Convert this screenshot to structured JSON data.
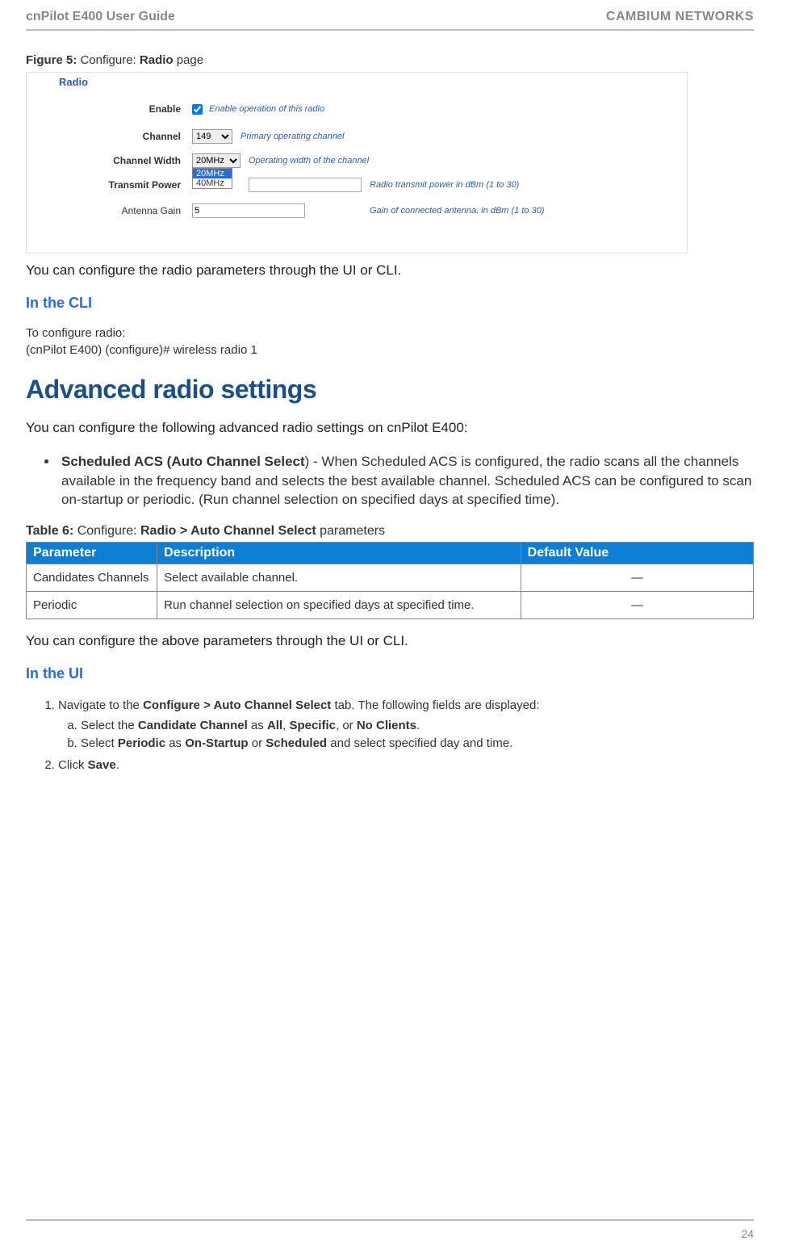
{
  "header": {
    "left": "cnPilot E400 User Guide",
    "right": "CAMBIUM NETWORKS"
  },
  "figure": {
    "label_prefix": "Figure 5:",
    "label_mid": " Configure: ",
    "label_bold": "Radio",
    "label_suffix": " page"
  },
  "radio_panel": {
    "title": "Radio",
    "rows": {
      "enable": {
        "label": "Enable",
        "hint": "Enable operation of this radio",
        "checked": true
      },
      "channel": {
        "label": "Channel",
        "value": "149",
        "hint": "Primary operating channel"
      },
      "channel_width": {
        "label": "Channel Width",
        "value": "20MHz",
        "hint": "Operating width of the channel",
        "options": [
          "20MHz",
          "40MHz"
        ],
        "selected_option": "20MHz"
      },
      "tx_power": {
        "label": "Transmit Power",
        "value": "",
        "hint": "Radio transmit power in dBm (1 to 30)"
      },
      "antenna_gain": {
        "label": "Antenna Gain",
        "value": "5",
        "hint": "Gain of connected antenna, in dBm (1 to 30)"
      }
    }
  },
  "body": {
    "after_figure": "You can configure the radio parameters through the UI or CLI.",
    "cli_heading": "In the CLI",
    "cli_line1": "To configure radio:",
    "cli_line2": "(cnPilot E400) (configure)# wireless radio 1",
    "advanced_heading": "Advanced radio settings",
    "advanced_intro": "You can configure the following advanced radio settings on cnPilot E400:",
    "bullet_bold": "Scheduled ACS (Auto Channel Select",
    "bullet_rest": ") - When Scheduled ACS is configured, the radio scans all the channels available in the frequency band and selects the best available channel. Scheduled ACS can be configured to scan on-startup or periodic. (Run channel selection on specified days at specified time).",
    "after_table": "You can configure the above parameters through the UI or CLI.",
    "ui_heading": "In the UI"
  },
  "table6": {
    "caption_prefix": "Table 6:",
    "caption_mid": " Configure: ",
    "caption_bold": "Radio > Auto Channel Select",
    "caption_suffix": " parameters",
    "headers": [
      "Parameter",
      "Description",
      "Default Value"
    ],
    "rows": [
      {
        "param": "Candidates Channels",
        "desc": "Select available channel.",
        "default": "—"
      },
      {
        "param": "Periodic",
        "desc": "Run channel selection on specified days at specified time.",
        "default": "—"
      }
    ]
  },
  "steps": {
    "s1_pre": "Navigate to the ",
    "s1_bold": "Configure > Auto Channel Select",
    "s1_post": " tab. The following fields are displayed:",
    "s1a_pre": "Select the ",
    "s1a_b1": "Candidate Channel",
    "s1a_mid1": " as ",
    "s1a_b2": "All",
    "s1a_mid2": ", ",
    "s1a_b3": "Specific",
    "s1a_mid3": ", or ",
    "s1a_b4": "No Clients",
    "s1a_post": ".",
    "s1b_pre": "Select ",
    "s1b_b1": "Periodic",
    "s1b_mid1": " as ",
    "s1b_b2": "On-Startup",
    "s1b_mid2": " or ",
    "s1b_b3": "Scheduled",
    "s1b_post": " and select specified day and time.",
    "s2_pre": "Click ",
    "s2_b": "Save",
    "s2_post": "."
  },
  "page_number": "24"
}
